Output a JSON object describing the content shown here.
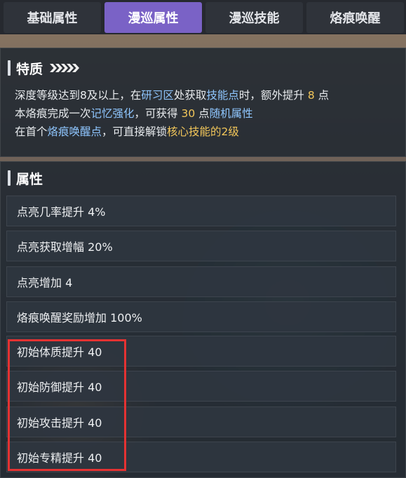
{
  "tabs": [
    {
      "label": "基础属性",
      "active": false
    },
    {
      "label": "漫巡属性",
      "active": true
    },
    {
      "label": "漫巡技能",
      "active": false
    },
    {
      "label": "烙痕唤醒",
      "active": false
    }
  ],
  "trait": {
    "title": "特质",
    "line1": {
      "a": "深度等级达到8及以上，在",
      "b": "研习区",
      "c": "处获取",
      "d": "技能点",
      "e": "时，额外提升 ",
      "f": "8",
      "g": " 点"
    },
    "line2": {
      "a": "本烙痕完成一次",
      "b": "记忆强化",
      "c": "，可获得 ",
      "d": "30",
      "e": " 点",
      "f": "随机属性"
    },
    "line3": {
      "a": "在首个",
      "b": "烙痕唤醒点",
      "c": "，可直接解锁",
      "d": "核心技能的2级"
    }
  },
  "attributes": {
    "title": "属性",
    "items": [
      "点亮几率提升 4%",
      "点亮获取增幅 20%",
      "点亮增加 4",
      "烙痕唤醒奖励增加 100%",
      "初始体质提升 40",
      "初始防御提升 40",
      "初始攻击提升 40",
      "初始专精提升 40"
    ]
  },
  "colors": {
    "active_tab": "#7a62c6",
    "highlight": "#8fc6ff",
    "gold": "#f3c75a",
    "annotation_box": "#e53232"
  }
}
